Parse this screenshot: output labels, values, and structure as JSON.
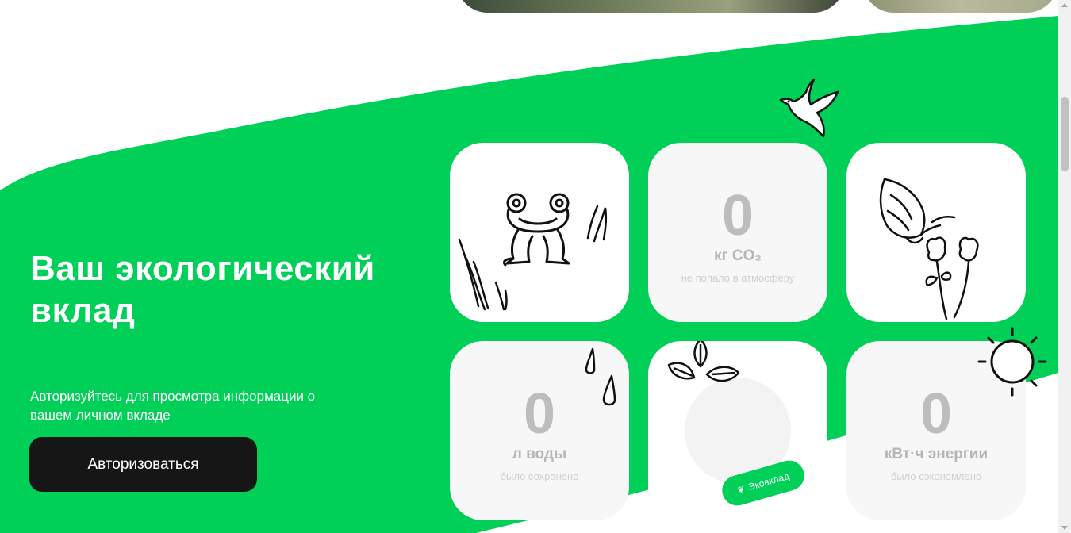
{
  "colors": {
    "brand_green": "#00cf58",
    "dark_button": "#161616",
    "tile_bg": "#f7f7f7"
  },
  "hero": {
    "title": "Ваш экологический вклад",
    "subtitle": "Авторизуйтесь для просмотра информации о вашем личном вкладе",
    "login_button": "Авторизоваться"
  },
  "stats": {
    "co2": {
      "value": "0",
      "unit": "кг CO₂",
      "description": "не попало в атмосферу"
    },
    "water": {
      "value": "0",
      "unit": "л воды",
      "description": "было сохранено"
    },
    "energy": {
      "value": "0",
      "unit": "кВт·ч энергии",
      "description": "было сэкономлено"
    }
  },
  "eco_badge": {
    "label": "Эковклад",
    "icon": "leaf-icon"
  },
  "illustrations": [
    "frog-icon",
    "grass-icon",
    "butterfly-icon",
    "flowers-icon",
    "dove-icon",
    "raindrop-icon",
    "leaves-icon",
    "sun-icon"
  ]
}
